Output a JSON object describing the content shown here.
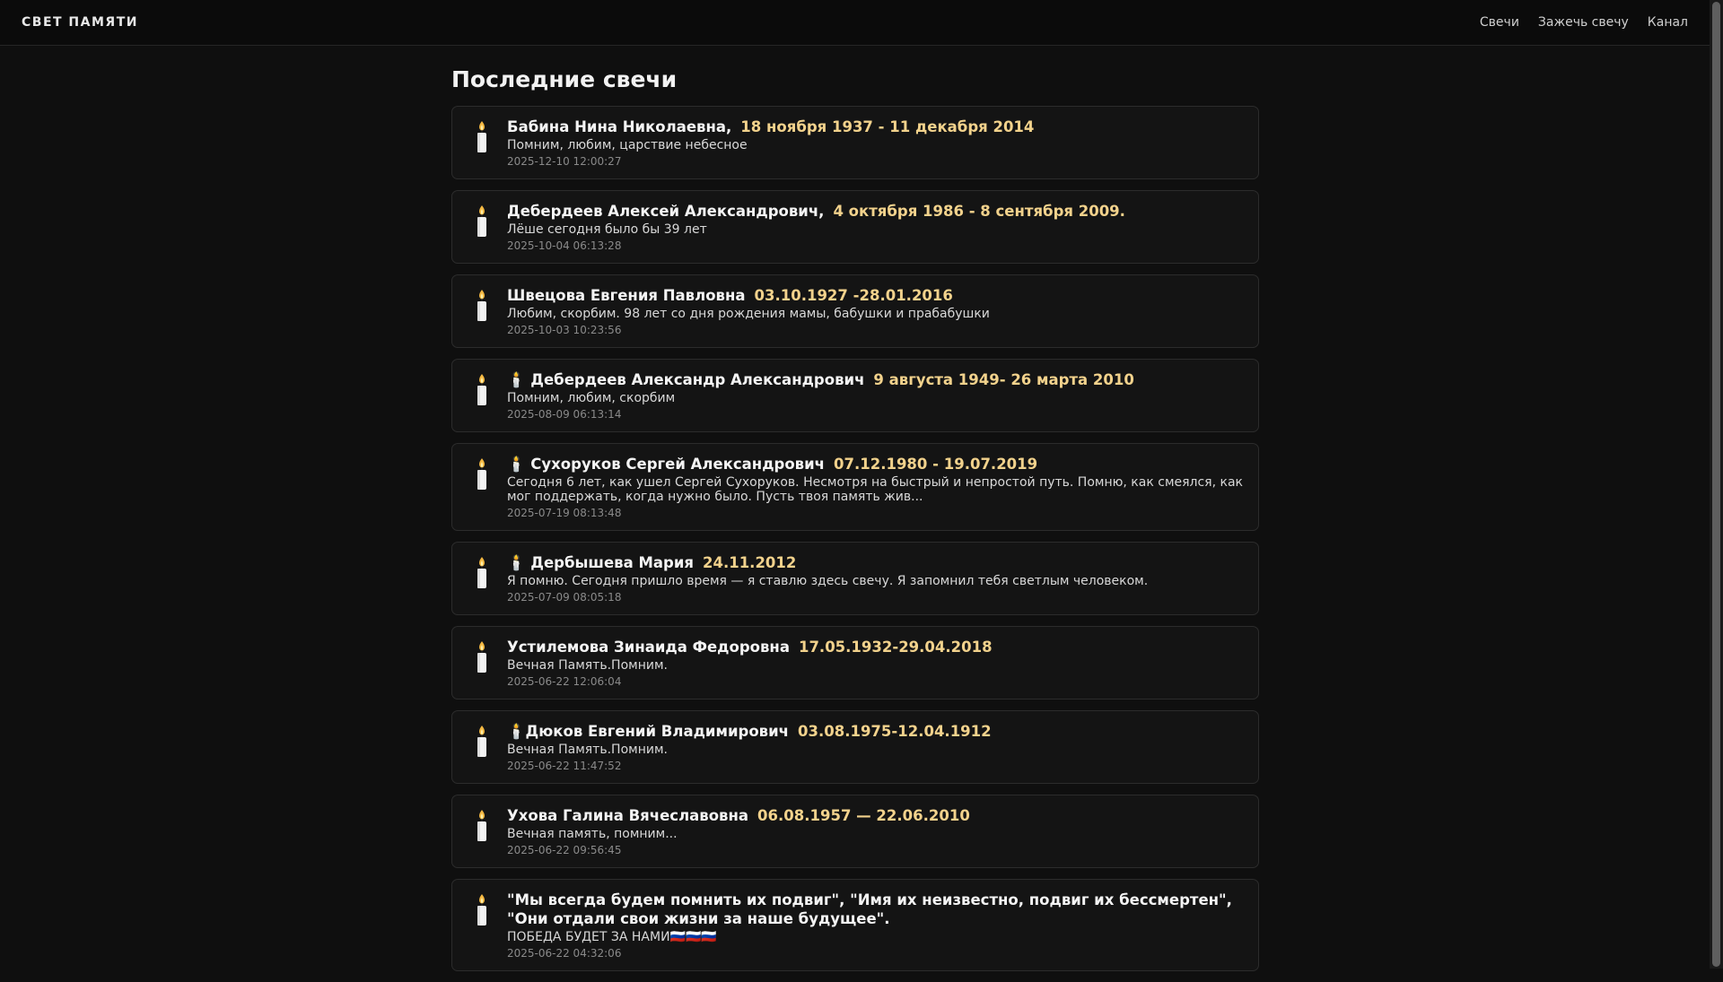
{
  "header": {
    "brand": "СВЕТ ПАМЯТИ",
    "nav": [
      "Свечи",
      "Зажечь свечу",
      "Канал"
    ]
  },
  "main": {
    "title": "Последние свечи",
    "cards": [
      {
        "name": "Бабина Нина Николаевна,",
        "dates": "18 ноября 1937 - 11 декабря 2014",
        "message": "Помним, любим, царствие небесное",
        "time": "2025-12-10 12:00:27"
      },
      {
        "name": "Дебердеев Алексей Александрович,",
        "dates": "4 октября 1986 - 8 сентября 2009.",
        "message": "Лёше сегодня было бы 39 лет",
        "time": "2025-10-04 06:13:28"
      },
      {
        "name": "Швецова Евгения Павловна",
        "dates": "03.10.1927 -28.01.2016",
        "message": "Любим, скорбим. 98 лет со дня рождения мамы, бабушки и прабабушки",
        "time": "2025-10-03 10:23:56"
      },
      {
        "name": "🕯️ Дебердеев Александр Александрович",
        "dates": "9 августа 1949- 26 марта 2010",
        "message": "Помним, любим, скорбим",
        "time": "2025-08-09 06:13:14"
      },
      {
        "name": "🕯️ Сухоруков Сергей Александрович",
        "dates": "07.12.1980 - 19.07.2019",
        "message": "Сегодня 6 лет, как ушел Сергей Сухоруков. Несмотря на быстрый и непростой путь. Помню, как смеялся, как мог поддержать, когда нужно было. Пусть твоя память жив...",
        "time": "2025-07-19 08:13:48"
      },
      {
        "name": "🕯️ Дербышева Мария",
        "dates": "24.11.2012",
        "message": "Я помню. Сегодня пришло время — я ставлю здесь свечу. Я запомнил тебя светлым человеком.",
        "time": "2025-07-09 08:05:18"
      },
      {
        "name": "Устилемова Зинаида Федоровна",
        "dates": "17.05.1932-29.04.2018",
        "message": "Вечная Память.Помним.",
        "time": "2025-06-22 12:06:04"
      },
      {
        "name": "🕯️Дюков Евгений Владимирович",
        "dates": "03.08.1975-12.04.1912",
        "message": "Вечная Память.Помним.",
        "time": "2025-06-22 11:47:52"
      },
      {
        "name": "Ухова Галина Вячеславовна",
        "dates": "06.08.1957 — 22.06.2010",
        "message": "Вечная память, помним...",
        "time": "2025-06-22 09:56:45"
      },
      {
        "name": "\"Мы всегда будем помнить их подвиг\", \"Имя их неизвестно, подвиг их бессмертен\", \"Они отдали свои жизни за наше будущее\".",
        "dates": "",
        "message": "ПОБЕДА БУДЕТ ЗА НАМИ🇷🇺🇷🇺🇷🇺",
        "time": "2025-06-22 04:32:06"
      }
    ]
  },
  "colors": {
    "background": "#0f0f0f",
    "card": "#141414",
    "dates": "#f2d28c",
    "muted": "#8a8a8a"
  },
  "icons": {
    "candle": "candle-icon"
  }
}
